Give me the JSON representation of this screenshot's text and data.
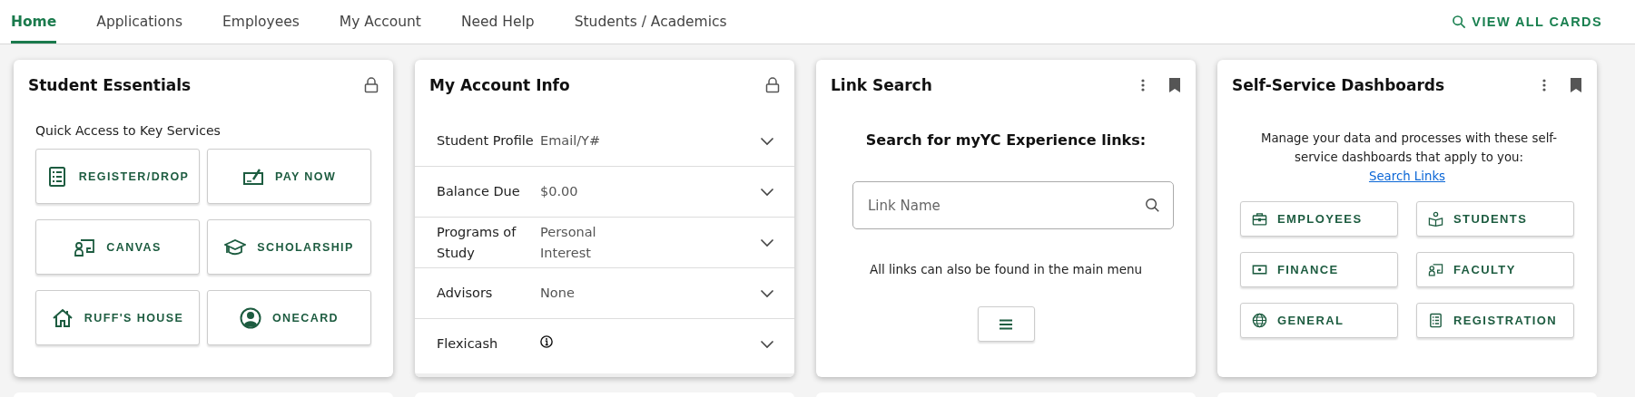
{
  "nav": {
    "tabs": [
      {
        "label": "Home",
        "selected": true
      },
      {
        "label": "Applications",
        "selected": false
      },
      {
        "label": "Employees",
        "selected": false
      },
      {
        "label": "My Account",
        "selected": false
      },
      {
        "label": "Need Help",
        "selected": false
      },
      {
        "label": "Students / Academics",
        "selected": false
      }
    ],
    "view_all": "VIEW ALL CARDS"
  },
  "cards": [
    {
      "kind": "essentials",
      "title": "Student Essentials",
      "locked": true,
      "subtitle": "Quick Access to Key Services",
      "buttons": [
        "REGISTER/DROP",
        "PAY NOW",
        "CANVAS",
        "SCHOLARSHIP",
        "RUFF'S HOUSE",
        "ONECARD"
      ]
    },
    {
      "kind": "account",
      "title": "My Account Info",
      "locked": true,
      "rows": [
        {
          "kind": "text",
          "label": "Student Profile",
          "value": "Email/Y#",
          "expanded": false
        },
        {
          "kind": "text",
          "label": "Balance Due",
          "value": "$0.00",
          "expanded": false
        },
        {
          "kind": "text",
          "label": "Programs of Study",
          "value": "Personal Interest",
          "expanded": false
        },
        {
          "kind": "text",
          "label": "Advisors",
          "value": "None",
          "expanded": false
        },
        {
          "kind": "info",
          "label": "Flexicash",
          "expanded": false
        }
      ]
    },
    {
      "kind": "link_search",
      "title": "Link Search",
      "locked": false,
      "bookmarked": true,
      "heading": "Search for myYC Experience links:",
      "search": {
        "placeholder": "Link Name"
      },
      "note": "All links can also be found in the main menu"
    },
    {
      "kind": "dashboards",
      "title": "Self-Service Dashboards",
      "locked": false,
      "bookmarked": true,
      "description": "Manage your data and processes with these self-service dashboards that apply to you:",
      "link": "Search Links",
      "buttons": [
        "EMPLOYEES",
        "STUDENTS",
        "FINANCE",
        "FACULTY",
        "GENERAL",
        "REGISTRATION"
      ]
    }
  ]
}
